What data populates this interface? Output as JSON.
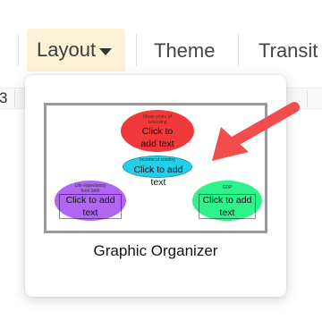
{
  "toolbar": {
    "layout_label": "Layout",
    "theme_label": "Theme",
    "transitions_label": "Transit"
  },
  "strip": {
    "value": "3"
  },
  "dropdown": {
    "caption": "Graphic Organizer",
    "nodes": {
      "red": {
        "title": "Mean years of schooling",
        "text": "Click to add text",
        "color": "#f1383a"
      },
      "cyan": {
        "title": "Income of country",
        "text": "Click to add text",
        "color": "#22cfe8"
      },
      "purple": {
        "title": "Life expectancy from birth",
        "text": "Click to add text",
        "color": "#b066f2"
      },
      "green": {
        "title": "GDP",
        "text": "Click to add text",
        "color": "#2ef28a"
      }
    }
  },
  "annotation": {
    "arrow_color": "#f24c4c"
  },
  "colors": {
    "layout_active_bg": "#fdf1d6",
    "frame_border": "#9a9a9a"
  }
}
